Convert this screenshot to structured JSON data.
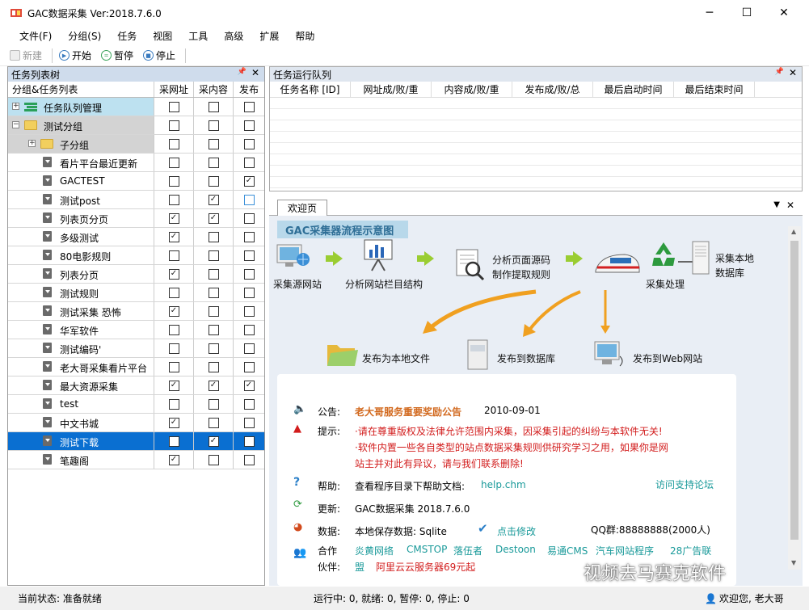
{
  "window": {
    "title": "GAC数据采集 Ver:2018.7.6.0",
    "minimize": "─",
    "maximize": "☐",
    "close": "✕"
  },
  "menu": [
    "文件(F)",
    "分组(S)",
    "任务",
    "视图",
    "工具",
    "高级",
    "扩展",
    "帮助"
  ],
  "toolbar": {
    "new": "新建",
    "start": "开始",
    "pause": "暂停",
    "stop": "停止"
  },
  "tree": {
    "title": "任务列表树",
    "pin": "📌",
    "close": "✕",
    "headers": [
      "分组&任务列表",
      "采网址",
      "采内容",
      "发布"
    ],
    "rows": [
      {
        "label": "任务队列管理",
        "type": "queue",
        "checks": [
          false,
          false,
          false
        ]
      },
      {
        "label": "测试分组",
        "type": "group",
        "checks": [
          false,
          false,
          false
        ]
      },
      {
        "label": "子分组",
        "type": "subgroup",
        "checks": [
          false,
          false,
          false
        ]
      },
      {
        "label": "看片平台最近更新",
        "type": "task",
        "checks": [
          false,
          false,
          false
        ]
      },
      {
        "label": "GACTEST",
        "type": "task",
        "checks": [
          false,
          false,
          true
        ]
      },
      {
        "label": "测试post",
        "type": "task",
        "checks": [
          false,
          true,
          false
        ]
      },
      {
        "label": "列表页分页",
        "type": "task",
        "checks": [
          true,
          true,
          false
        ]
      },
      {
        "label": "多级测试",
        "type": "task",
        "checks": [
          true,
          false,
          false
        ]
      },
      {
        "label": "80电影规则",
        "type": "task",
        "checks": [
          false,
          false,
          false
        ]
      },
      {
        "label": "列表分页",
        "type": "task",
        "checks": [
          true,
          false,
          false
        ]
      },
      {
        "label": "测试规则",
        "type": "task",
        "checks": [
          false,
          false,
          false
        ]
      },
      {
        "label": "测试采集 恐怖",
        "type": "task",
        "checks": [
          true,
          false,
          false
        ]
      },
      {
        "label": "华军软件",
        "type": "task",
        "checks": [
          false,
          false,
          false
        ]
      },
      {
        "label": "测试编码'",
        "type": "task",
        "checks": [
          false,
          false,
          false
        ]
      },
      {
        "label": "老大哥采集看片平台",
        "type": "task",
        "checks": [
          false,
          false,
          false
        ]
      },
      {
        "label": "最大资源采集",
        "type": "task",
        "checks": [
          true,
          true,
          true
        ]
      },
      {
        "label": "test",
        "type": "task",
        "checks": [
          false,
          false,
          false
        ]
      },
      {
        "label": "中文书城",
        "type": "task",
        "checks": [
          true,
          false,
          false
        ]
      },
      {
        "label": "测试下载",
        "type": "task",
        "checks": [
          false,
          true,
          false
        ],
        "selected": true
      },
      {
        "label": "笔趣阁",
        "type": "task",
        "checks": [
          true,
          false,
          false
        ]
      }
    ]
  },
  "queue": {
    "title": "任务运行队列",
    "headers": [
      "任务名称 [ID]",
      "网址成/败/重",
      "内容成/败/重",
      "发布成/败/总",
      "最后启动时间",
      "最后结束时间"
    ]
  },
  "welcome": {
    "tab": "欢迎页",
    "banner": "GAC采集器流程示意图",
    "flow": {
      "source": "采集源网站",
      "analyze_site": "分析网站栏目结构",
      "analyze_page": "分析页面源码",
      "extract_rules": "制作提取规则",
      "process": "采集处理",
      "local_db_1": "采集本地",
      "local_db_2": "数据库",
      "pub_file": "发布为本地文件",
      "pub_db": "发布到数据库",
      "pub_web": "发布到Web网站"
    },
    "notice_label": "公告:",
    "notice_text": "老大哥服务重要奖励公告",
    "notice_date": "2010-09-01",
    "tip_label": "提示:",
    "tip_1": "·请在尊重版权及法律允许范围内采集，因采集引起的纠纷与本软件无关!",
    "tip_2": "·软件内置一些各自类型的站点数据采集规则供研究学习之用，如果你是网",
    "tip_3": "站主并对此有异议，请与我们联系删除!",
    "help_label": "帮助:",
    "help_text": "查看程序目录下帮助文档:",
    "help_link": "help.chm",
    "forum_link": "访问支持论坛",
    "update_label": "更新:",
    "update_text": "GAC数据采集 2018.7.6.0",
    "data_label": "数据:",
    "data_text": "本地保存数据: Sqlite",
    "data_link": "点击修改",
    "qq": "QQ群:88888888(2000人)",
    "partner_label_1": "合作",
    "partner_label_2": "伙伴:",
    "partners": [
      "炎黄网络",
      "CMSTOP",
      "落伍者",
      "Destoon",
      "易通CMS",
      "汽车网站程序",
      "28广告联"
    ],
    "partner_cont": "盟",
    "promo": "阿里云云服务器69元起"
  },
  "status": {
    "state": "当前状态: 准备就绪",
    "counts": "运行中: 0, 就绪: 0, 暂停: 0, 停止: 0",
    "welcome": "欢迎您, 老大哥"
  },
  "watermark": "视频去马赛克软件"
}
